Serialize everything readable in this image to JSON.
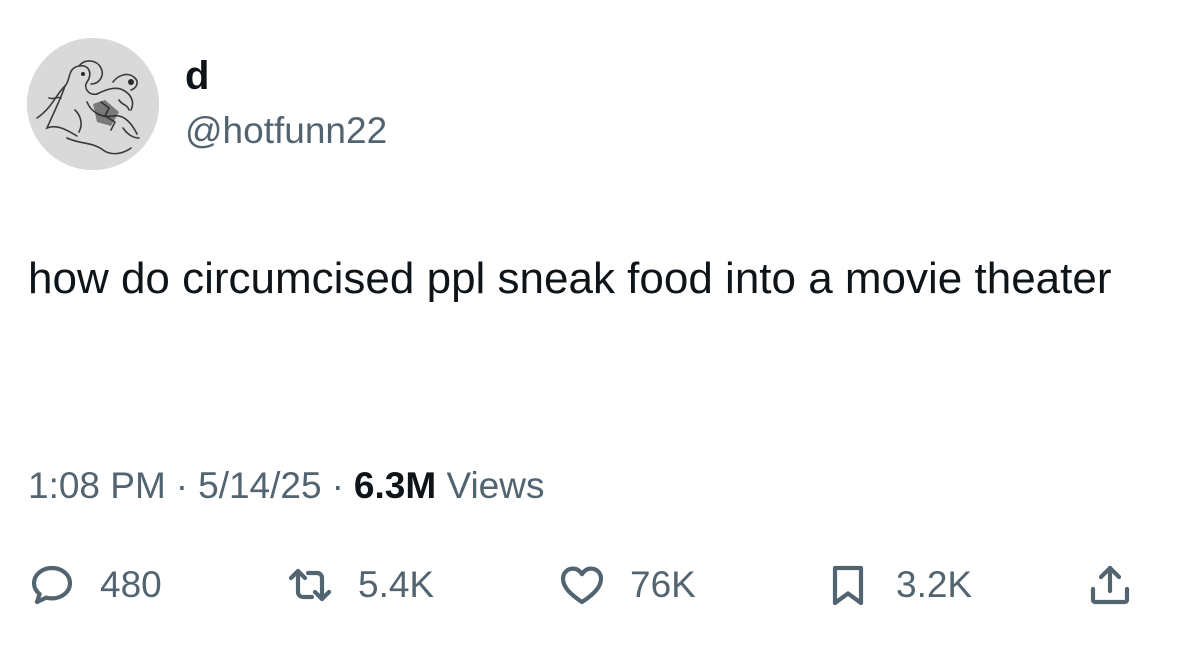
{
  "author": {
    "display_name": "d",
    "handle": "@hotfunn22",
    "avatar_icon": "sketch-avatar-icon"
  },
  "tweet": {
    "text": "how do circumcised ppl sneak food into a movie theater"
  },
  "meta": {
    "time": "1:08 PM",
    "date": "5/14/25",
    "views_count": "6.3M",
    "views_label": "Views",
    "separator": "·"
  },
  "actions": {
    "reply": {
      "icon": "reply-icon",
      "count": "480"
    },
    "retweet": {
      "icon": "retweet-icon",
      "count": "5.4K"
    },
    "like": {
      "icon": "heart-icon",
      "count": "76K"
    },
    "bookmark": {
      "icon": "bookmark-icon",
      "count": "3.2K"
    },
    "share": {
      "icon": "share-icon"
    }
  },
  "colors": {
    "text_primary": "#0f1419",
    "text_secondary": "#536471",
    "background": "#ffffff"
  }
}
